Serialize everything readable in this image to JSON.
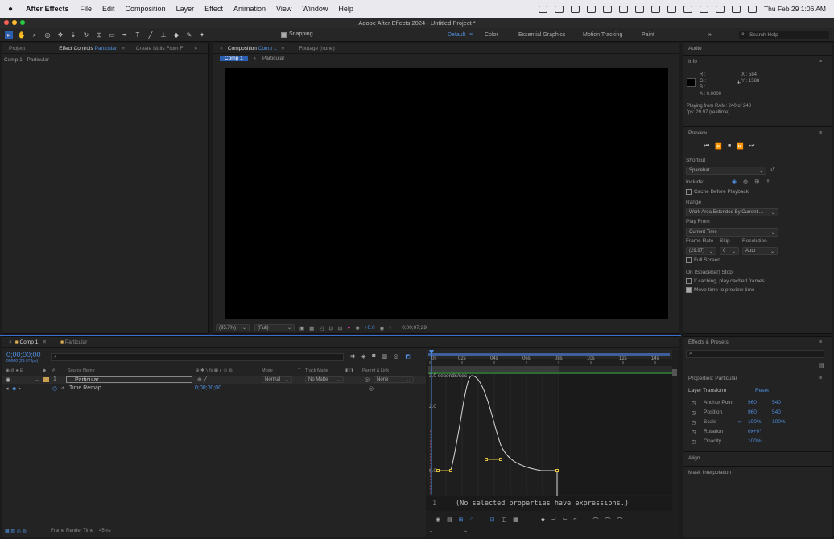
{
  "menubar": {
    "app": "After Effects",
    "items": [
      "File",
      "Edit",
      "Composition",
      "Layer",
      "Effect",
      "Animation",
      "View",
      "Window",
      "Help"
    ],
    "datetime": "Thu Feb 29  1:06 AM"
  },
  "window": {
    "title": "Adobe After Effects 2024 - Untitled Project *"
  },
  "toolbar": {
    "snapping": "Snapping",
    "workspaces": [
      "Default",
      "Color",
      "Essential Graphics",
      "Motion Tracking",
      "Paint"
    ],
    "search_placeholder": "Search Help"
  },
  "left_panel": {
    "tabs": [
      "Project",
      "Effect Controls Particular",
      "Create Nulls From F"
    ],
    "tab_prefix": "Effect Controls",
    "tab_layer": "Particular",
    "breadcrumb": "Comp 1 - Particular"
  },
  "comp_panel": {
    "tab_prefix": "Composition",
    "tab_name": "Comp 1",
    "footage": "Footage (none)",
    "crumbs": [
      "Comp 1",
      "Particular"
    ],
    "zoom": "(95.7%)",
    "resolution": "(Full)",
    "exposure": "+0.0",
    "timecode": "0;00;07;29"
  },
  "right_panel": {
    "audio": "Audio",
    "info": {
      "title": "Info",
      "r": "R :",
      "g": "G :",
      "b": "B :",
      "a": "A :  0.0000",
      "x": "X : 584",
      "y": "Y : 1588",
      "playing": "Playing from RAM: 240 of 240",
      "fps": "fps: 29.97 (realtime)"
    },
    "preview": {
      "title": "Preview",
      "shortcut_label": "Shortcut",
      "shortcut": "Spacebar",
      "include": "Include:",
      "cache": "Cache Before Playback",
      "range_label": "Range",
      "range": "Work Area Extended By Current ...",
      "playfrom_label": "Play From",
      "playfrom": "Current Time",
      "framerate_label": "Frame Rate",
      "skip_label": "Skip",
      "res_label": "Resolution",
      "framerate": "(29.97)",
      "skip": "0",
      "res": "Auto",
      "fullscreen": "Full Screen",
      "stop_label": "On (Spacebar) Stop:",
      "if_caching": "If caching, play cached frames",
      "move_time": "Move time to preview time"
    },
    "effects": {
      "title": "Effects & Presets"
    },
    "properties": {
      "title": "Properties: Particular",
      "section": "Layer Transform",
      "reset": "Reset",
      "rows": [
        {
          "name": "Anchor Point",
          "v1": "960",
          "v2": "540"
        },
        {
          "name": "Position",
          "v1": "960",
          "v2": "540"
        },
        {
          "name": "Scale",
          "v1": "100%",
          "v2": "100%"
        },
        {
          "name": "Rotation",
          "v1": "0x+0°",
          "v2": ""
        },
        {
          "name": "Opacity",
          "v1": "100%",
          "v2": ""
        }
      ]
    },
    "align": "Align",
    "mask_interp": "Mask Interpolation"
  },
  "timeline": {
    "tabs": [
      "Comp 1",
      "Particular"
    ],
    "timecode": "0;00;00;00",
    "timecode_sub": "00000 (29.97 fps)",
    "columns": {
      "num": "#",
      "source": "Source Name",
      "mode": "Mode",
      "t": "T",
      "trackmatte": "Track Matte",
      "parent": "Parent & Link"
    },
    "layer": {
      "num": "1",
      "name": "Particular",
      "mode": "Normal",
      "matte": "No Matte",
      "parent": "None"
    },
    "prop": {
      "name": "Time Remap",
      "value": "0;00;00;00"
    },
    "ruler": [
      "0s",
      "02s",
      "04s",
      "06s",
      "08s",
      "10s",
      "12s",
      "14s"
    ],
    "graph": {
      "units": "3.0 seconds/sec",
      "y2": "2.0",
      "y0": "0.0",
      "key_x": [
        0.5,
        1.3,
        6.4,
        6.9,
        14.3
      ],
      "key_y": [
        0,
        0,
        0.35,
        0.35,
        0
      ],
      "peak_x": 2.6,
      "peak_y": 2.95
    },
    "expr_line": "1",
    "expr_text": "(No selected properties have expressions.)",
    "status": "Frame Render Time",
    "status_ms": "45ms"
  }
}
